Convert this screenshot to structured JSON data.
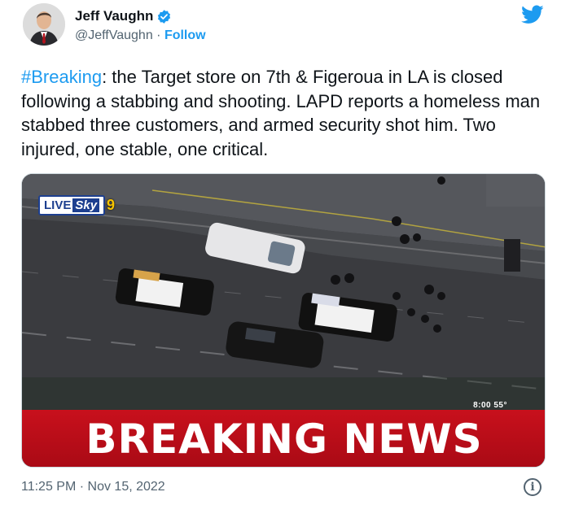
{
  "author": {
    "name": "Jeff Vaughn",
    "handle": "@JeffVaughn",
    "separator": " · ",
    "follow_label": "Follow",
    "verified": true
  },
  "tweet": {
    "hashtag": "#Breaking",
    "text": ": the Target store on 7th & Figeroua in LA is closed following a stabbing and shooting. LAPD reports a homeless man stabbed three customers, and armed security shot him. Two injured, one stable, one critical.",
    "timestamp": "11:25 PM · Nov 15, 2022"
  },
  "media": {
    "live_label": "LIVE",
    "sky_label": "Sky",
    "channel_number": "9",
    "time_overlay": "8:00  55°",
    "banner_text": "BREAKING NEWS"
  },
  "icons": {
    "brand": "twitter-bird-icon",
    "verified": "verified-badge-icon",
    "info": "info-icon"
  },
  "colors": {
    "accent": "#1d9bf0",
    "banner_red": "#c8101c",
    "text_primary": "#0f1419",
    "text_secondary": "#536471"
  }
}
